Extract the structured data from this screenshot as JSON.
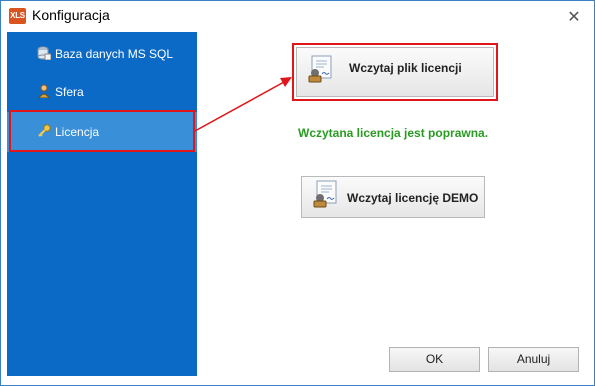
{
  "window": {
    "app_icon_text": "XLS",
    "title": "Konfiguracja",
    "close_glyph": "✕"
  },
  "sidebar": {
    "items": [
      {
        "label": "Baza danych MS SQL",
        "icon": "database-icon"
      },
      {
        "label": "Sfera",
        "icon": "person-icon"
      },
      {
        "label": "Licencja",
        "icon": "key-icon",
        "active": true
      }
    ]
  },
  "main": {
    "load_license_button": "Wczytaj plik licencji",
    "status_message": "Wczytana licencja jest poprawna.",
    "load_demo_button": "Wczytaj licencję DEMO"
  },
  "footer": {
    "ok_label": "OK",
    "cancel_label": "Anuluj"
  },
  "colors": {
    "sidebar_bg": "#0c6ac7",
    "sidebar_active": "#3a8fd9",
    "highlight": "#e0161a",
    "status_ok": "#2a9b22"
  }
}
